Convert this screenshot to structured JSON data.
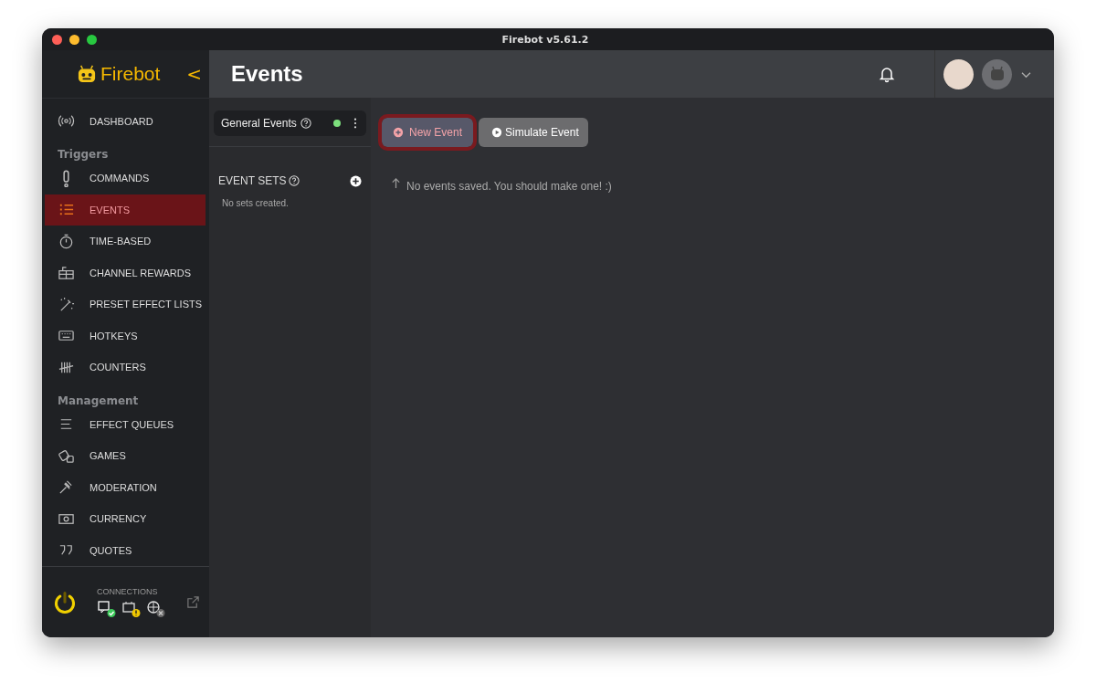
{
  "window": {
    "title": "Firebot v5.61.2"
  },
  "sidebar": {
    "logo": "Firebot",
    "collapse_glyph": "<",
    "sections": [
      {
        "items": [
          {
            "label": "DASHBOARD",
            "selected": false
          }
        ]
      },
      {
        "heading": "Triggers",
        "items": [
          {
            "label": "COMMANDS",
            "selected": false
          },
          {
            "label": "EVENTS",
            "selected": true
          },
          {
            "label": "TIME-BASED",
            "selected": false
          },
          {
            "label": "CHANNEL REWARDS",
            "selected": false
          },
          {
            "label": "PRESET EFFECT LISTS",
            "selected": false
          },
          {
            "label": "HOTKEYS",
            "selected": false
          },
          {
            "label": "COUNTERS",
            "selected": false
          }
        ]
      },
      {
        "heading": "Management",
        "items": [
          {
            "label": "EFFECT QUEUES",
            "selected": false
          },
          {
            "label": "GAMES",
            "selected": false
          },
          {
            "label": "MODERATION",
            "selected": false
          },
          {
            "label": "CURRENCY",
            "selected": false
          },
          {
            "label": "QUOTES",
            "selected": false
          }
        ]
      }
    ],
    "connections": {
      "label": "CONNECTIONS",
      "items": [
        {
          "connected": true,
          "warning": false
        },
        {
          "connected": false,
          "warning": true
        },
        {
          "connected": false,
          "warning": false
        }
      ]
    }
  },
  "header": {
    "title": "Events"
  },
  "event_groups": {
    "general": {
      "label": "General Events",
      "active": true
    },
    "sets_heading": "EVENT SETS",
    "empty_text": "No sets created."
  },
  "main": {
    "buttons": [
      {
        "label": "New Event",
        "selected": true
      },
      {
        "label": "Simulate Event",
        "selected": false
      }
    ],
    "empty_text": "No events saved. You should make one! :)"
  }
}
